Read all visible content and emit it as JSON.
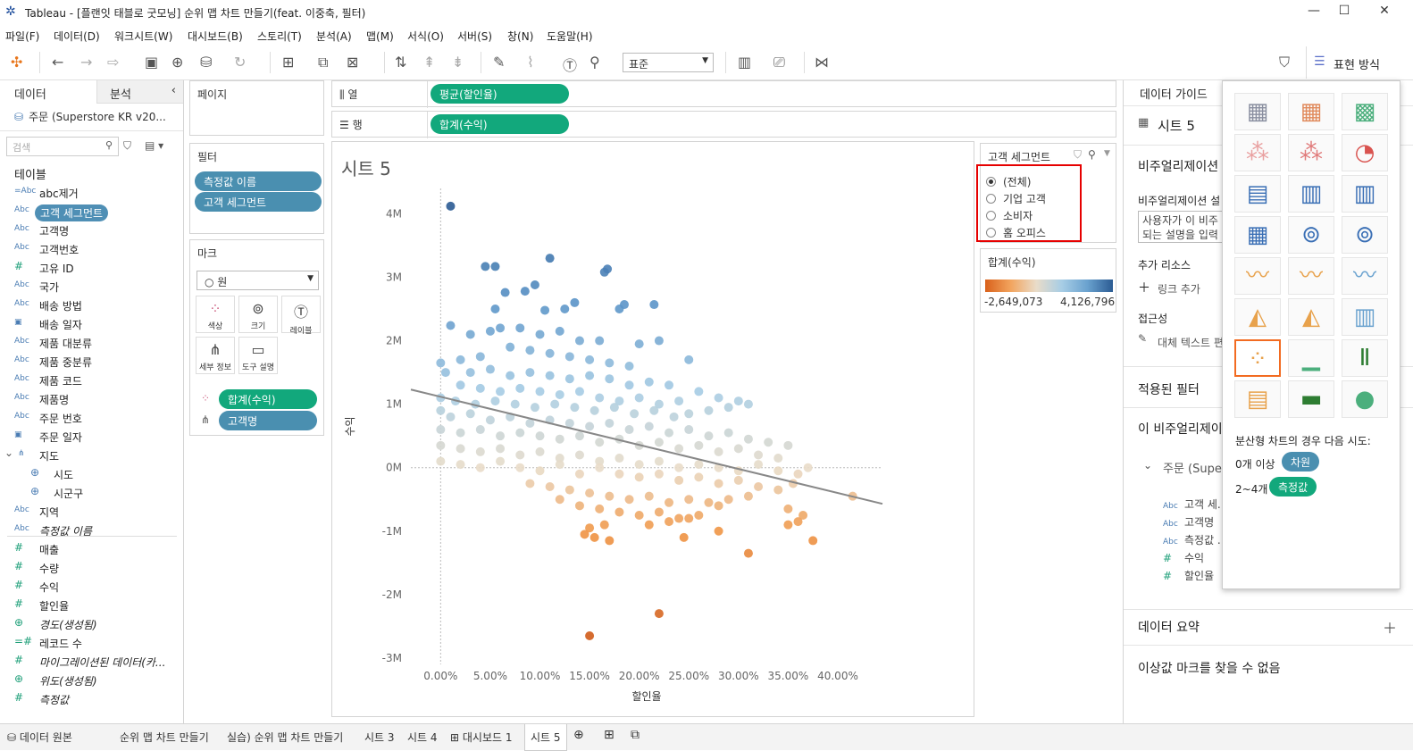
{
  "window": {
    "title": "Tableau - [플랜잇 태블로 굿모닝] 순위 맵 차트 만들기(feat. 이중축, 필터)"
  },
  "menu": [
    "파일(F)",
    "데이터(D)",
    "워크시트(W)",
    "대시보드(B)",
    "스토리(T)",
    "분석(A)",
    "맵(M)",
    "서식(O)",
    "서버(S)",
    "창(N)",
    "도움말(H)"
  ],
  "toolbar": {
    "fit": "표준",
    "showme": "표현 방식"
  },
  "datapane": {
    "tab_data": "데이터",
    "tab_analysis": "분석",
    "source": "주문 (Superstore KR v20...",
    "search_placeholder": "검색",
    "tables_label": "테이블",
    "fields": [
      {
        "icon": "=Abc",
        "name": "abc제거"
      },
      {
        "icon": "Abc",
        "name": "고객 세그먼트",
        "selected": true
      },
      {
        "icon": "Abc",
        "name": "고객명"
      },
      {
        "icon": "Abc",
        "name": "고객번호"
      },
      {
        "icon": "#",
        "name": "고유 ID"
      },
      {
        "icon": "Abc",
        "name": "국가"
      },
      {
        "icon": "Abc",
        "name": "배송 방법"
      },
      {
        "icon": "date",
        "name": "배송 일자"
      },
      {
        "icon": "Abc",
        "name": "제품 대분류"
      },
      {
        "icon": "Abc",
        "name": "제품 중분류"
      },
      {
        "icon": "Abc",
        "name": "제품 코드"
      },
      {
        "icon": "Abc",
        "name": "제품명"
      },
      {
        "icon": "Abc",
        "name": "주문 번호"
      },
      {
        "icon": "date",
        "name": "주문 일자"
      },
      {
        "icon": "geo",
        "name": "지도",
        "folder": true
      },
      {
        "icon": "globe",
        "name": "시도",
        "indent": true
      },
      {
        "icon": "globe",
        "name": "시군구",
        "indent": true
      },
      {
        "icon": "Abc",
        "name": "지역"
      },
      {
        "icon": "Abc",
        "name": "측정값 이름",
        "italic": true
      }
    ],
    "measures": [
      {
        "icon": "#",
        "name": "매출"
      },
      {
        "icon": "#",
        "name": "수량"
      },
      {
        "icon": "#",
        "name": "수익"
      },
      {
        "icon": "#",
        "name": "할인율"
      },
      {
        "icon": "globe",
        "name": "경도(생성됨)",
        "italic": true
      },
      {
        "icon": "=#",
        "name": "레코드 수"
      },
      {
        "icon": "#",
        "name": "마이그레이션된 데이터(카...",
        "italic": true
      },
      {
        "icon": "globe",
        "name": "위도(생성됨)",
        "italic": true
      },
      {
        "icon": "#",
        "name": "측정값",
        "italic": true
      }
    ]
  },
  "shelves": {
    "pages": "페이지",
    "columns_label": "열",
    "columns_pill": "평균(할인율)",
    "rows_label": "행",
    "rows_pill": "합계(수익)",
    "filters": "필터",
    "filter_pills": [
      "측정값 이름",
      "고객 세그먼트"
    ],
    "marks": "마크",
    "mark_type": "원",
    "mark_buttons": [
      "색상",
      "크기",
      "레이블",
      "세부 정보",
      "도구 설명"
    ],
    "mark_pills": [
      "합계(수익)",
      "고객명"
    ]
  },
  "viz": {
    "title": "시트 5"
  },
  "chart_data": {
    "type": "scatter",
    "xlabel": "할인율",
    "ylabel": "수익",
    "xlim": [
      -0.03,
      0.445
    ],
    "ylim": [
      -3.1,
      4.4
    ],
    "x_ticks": [
      "0.00%",
      "5.00%",
      "10.00%",
      "15.00%",
      "20.00%",
      "25.00%",
      "30.00%",
      "35.00%",
      "40.00%"
    ],
    "x_tick_values": [
      0,
      0.05,
      0.1,
      0.15,
      0.2,
      0.25,
      0.3,
      0.35,
      0.4
    ],
    "y_ticks": [
      "4M",
      "3M",
      "2M",
      "1M",
      "0M",
      "-1M",
      "-2M",
      "-3M"
    ],
    "y_tick_values": [
      4,
      3,
      2,
      1,
      0,
      -1,
      -2,
      -3
    ],
    "trend_line": {
      "x": [
        -0.03,
        0.445
      ],
      "y": [
        1.23,
        -0.57
      ]
    },
    "color_range": [
      -2.649073,
      4.126796
    ],
    "points": [
      [
        0.01,
        4.12
      ],
      [
        0.045,
        3.17
      ],
      [
        0.055,
        3.17
      ],
      [
        0.11,
        3.3
      ],
      [
        0.165,
        3.08
      ],
      [
        0.168,
        3.13
      ],
      [
        0.095,
        2.88
      ],
      [
        0.085,
        2.78
      ],
      [
        0.065,
        2.76
      ],
      [
        0.135,
        2.6
      ],
      [
        0.125,
        2.5
      ],
      [
        0.055,
        2.5
      ],
      [
        0.105,
        2.48
      ],
      [
        0.18,
        2.5
      ],
      [
        0.185,
        2.57
      ],
      [
        0.215,
        2.57
      ],
      [
        0.01,
        2.24
      ],
      [
        0.03,
        2.1
      ],
      [
        0.05,
        2.15
      ],
      [
        0.06,
        2.2
      ],
      [
        0.08,
        2.2
      ],
      [
        0.1,
        2.1
      ],
      [
        0.12,
        2.15
      ],
      [
        0.14,
        2.0
      ],
      [
        0.16,
        2.0
      ],
      [
        0.2,
        1.95
      ],
      [
        0.22,
        2.0
      ],
      [
        0.07,
        1.9
      ],
      [
        0.09,
        1.85
      ],
      [
        0.11,
        1.8
      ],
      [
        0.13,
        1.75
      ],
      [
        0.15,
        1.7
      ],
      [
        0.17,
        1.65
      ],
      [
        0.19,
        1.6
      ],
      [
        0.25,
        1.7
      ],
      [
        0.02,
        1.7
      ],
      [
        0.04,
        1.75
      ],
      [
        0.0,
        1.65
      ],
      [
        0.005,
        1.5
      ],
      [
        0.03,
        1.5
      ],
      [
        0.05,
        1.55
      ],
      [
        0.07,
        1.45
      ],
      [
        0.09,
        1.5
      ],
      [
        0.11,
        1.45
      ],
      [
        0.13,
        1.4
      ],
      [
        0.15,
        1.45
      ],
      [
        0.17,
        1.4
      ],
      [
        0.19,
        1.3
      ],
      [
        0.21,
        1.35
      ],
      [
        0.23,
        1.3
      ],
      [
        0.26,
        1.2
      ],
      [
        0.28,
        1.1
      ],
      [
        0.3,
        1.05
      ],
      [
        0.31,
        1.0
      ],
      [
        0.29,
        0.95
      ],
      [
        0.27,
        0.9
      ],
      [
        0.25,
        0.85
      ],
      [
        0.02,
        1.3
      ],
      [
        0.04,
        1.25
      ],
      [
        0.06,
        1.2
      ],
      [
        0.08,
        1.25
      ],
      [
        0.1,
        1.2
      ],
      [
        0.12,
        1.15
      ],
      [
        0.14,
        1.2
      ],
      [
        0.16,
        1.1
      ],
      [
        0.18,
        1.05
      ],
      [
        0.2,
        1.1
      ],
      [
        0.22,
        1.0
      ],
      [
        0.24,
        1.05
      ],
      [
        0.0,
        1.1
      ],
      [
        0.015,
        1.05
      ],
      [
        0.035,
        1.0
      ],
      [
        0.055,
        1.05
      ],
      [
        0.075,
        1.0
      ],
      [
        0.095,
        0.95
      ],
      [
        0.115,
        1.0
      ],
      [
        0.135,
        0.95
      ],
      [
        0.155,
        0.9
      ],
      [
        0.175,
        0.95
      ],
      [
        0.195,
        0.85
      ],
      [
        0.215,
        0.9
      ],
      [
        0.235,
        0.8
      ],
      [
        0.0,
        0.9
      ],
      [
        0.01,
        0.8
      ],
      [
        0.03,
        0.85
      ],
      [
        0.05,
        0.75
      ],
      [
        0.07,
        0.8
      ],
      [
        0.09,
        0.7
      ],
      [
        0.11,
        0.75
      ],
      [
        0.13,
        0.7
      ],
      [
        0.15,
        0.65
      ],
      [
        0.17,
        0.7
      ],
      [
        0.19,
        0.6
      ],
      [
        0.21,
        0.65
      ],
      [
        0.23,
        0.55
      ],
      [
        0.25,
        0.6
      ],
      [
        0.27,
        0.5
      ],
      [
        0.29,
        0.55
      ],
      [
        0.31,
        0.45
      ],
      [
        0.33,
        0.4
      ],
      [
        0.35,
        0.35
      ],
      [
        0.0,
        0.6
      ],
      [
        0.02,
        0.55
      ],
      [
        0.04,
        0.6
      ],
      [
        0.06,
        0.5
      ],
      [
        0.08,
        0.55
      ],
      [
        0.1,
        0.5
      ],
      [
        0.12,
        0.45
      ],
      [
        0.14,
        0.5
      ],
      [
        0.16,
        0.4
      ],
      [
        0.18,
        0.45
      ],
      [
        0.2,
        0.35
      ],
      [
        0.22,
        0.4
      ],
      [
        0.24,
        0.3
      ],
      [
        0.26,
        0.35
      ],
      [
        0.28,
        0.25
      ],
      [
        0.3,
        0.3
      ],
      [
        0.32,
        0.2
      ],
      [
        0.34,
        0.15
      ],
      [
        0.0,
        0.35
      ],
      [
        0.02,
        0.3
      ],
      [
        0.04,
        0.25
      ],
      [
        0.06,
        0.3
      ],
      [
        0.08,
        0.2
      ],
      [
        0.1,
        0.25
      ],
      [
        0.12,
        0.15
      ],
      [
        0.14,
        0.2
      ],
      [
        0.16,
        0.1
      ],
      [
        0.18,
        0.15
      ],
      [
        0.2,
        0.05
      ],
      [
        0.22,
        0.1
      ],
      [
        0.24,
        0.0
      ],
      [
        0.26,
        0.05
      ],
      [
        0.28,
        0.0
      ],
      [
        0.3,
        -0.05
      ],
      [
        0.32,
        0.05
      ],
      [
        0.34,
        -0.05
      ],
      [
        0.36,
        -0.1
      ],
      [
        0.37,
        0.0
      ],
      [
        0.0,
        0.1
      ],
      [
        0.02,
        0.05
      ],
      [
        0.04,
        0.0
      ],
      [
        0.06,
        0.1
      ],
      [
        0.08,
        0.0
      ],
      [
        0.1,
        -0.05
      ],
      [
        0.12,
        0.05
      ],
      [
        0.14,
        -0.1
      ],
      [
        0.16,
        0.0
      ],
      [
        0.18,
        -0.1
      ],
      [
        0.2,
        -0.15
      ],
      [
        0.22,
        -0.1
      ],
      [
        0.24,
        -0.2
      ],
      [
        0.26,
        -0.15
      ],
      [
        0.28,
        -0.25
      ],
      [
        0.3,
        -0.2
      ],
      [
        0.32,
        -0.3
      ],
      [
        0.34,
        -0.35
      ],
      [
        0.355,
        -0.25
      ],
      [
        0.09,
        -0.25
      ],
      [
        0.11,
        -0.3
      ],
      [
        0.13,
        -0.35
      ],
      [
        0.15,
        -0.4
      ],
      [
        0.17,
        -0.45
      ],
      [
        0.19,
        -0.5
      ],
      [
        0.21,
        -0.45
      ],
      [
        0.23,
        -0.55
      ],
      [
        0.25,
        -0.5
      ],
      [
        0.27,
        -0.55
      ],
      [
        0.29,
        -0.5
      ],
      [
        0.31,
        -0.45
      ],
      [
        0.12,
        -0.5
      ],
      [
        0.14,
        -0.6
      ],
      [
        0.16,
        -0.65
      ],
      [
        0.18,
        -0.7
      ],
      [
        0.2,
        -0.75
      ],
      [
        0.22,
        -0.7
      ],
      [
        0.24,
        -0.8
      ],
      [
        0.26,
        -0.75
      ],
      [
        0.28,
        -0.6
      ],
      [
        0.35,
        -0.65
      ],
      [
        0.365,
        -0.75
      ],
      [
        0.415,
        -0.45
      ],
      [
        0.15,
        -0.95
      ],
      [
        0.165,
        -0.9
      ],
      [
        0.145,
        -1.05
      ],
      [
        0.21,
        -0.9
      ],
      [
        0.23,
        -0.85
      ],
      [
        0.25,
        -0.8
      ],
      [
        0.28,
        -1.0
      ],
      [
        0.35,
        -0.9
      ],
      [
        0.36,
        -0.85
      ],
      [
        0.375,
        -1.15
      ],
      [
        0.245,
        -1.1
      ],
      [
        0.17,
        -1.15
      ],
      [
        0.31,
        -1.35
      ],
      [
        0.155,
        -1.1
      ],
      [
        0.22,
        -2.3
      ],
      [
        0.15,
        -2.65
      ]
    ]
  },
  "legends": {
    "segment_title": "고객 세그먼트",
    "segment_options": [
      "(전체)",
      "기업 고객",
      "소비자",
      "홈 오피스"
    ],
    "profit_title": "합계(수익)",
    "profit_min": "-2,649,073",
    "profit_max": "4,126,796"
  },
  "guide": {
    "header": "데이터 가이드",
    "sheet": "시트 5",
    "viz_desc_label": "비주얼리제이션",
    "viz_desc_sub": "비주얼리제이션 설",
    "desc_placeholder_1": "사용자가 이 비주",
    "desc_placeholder_2": "되는 설명을 입력",
    "resources": "추가 리소스",
    "add_link": "링크 추가",
    "access": "접근성",
    "alt_text": "대체 텍스트 편",
    "applied_filters": "적용된 필터",
    "this_viz": "이 비주얼리제이",
    "source": "주문 (Supe",
    "guide_fields": [
      "고객 세...",
      "고객명",
      "측정값 ...",
      "수익",
      "할인율"
    ],
    "summary": "데이터 요약",
    "outliers": "이상값 마크를 찾을 수 없음"
  },
  "showme": {
    "hint": "분산형 차트의 경우 다음 시도:",
    "req1_prefix": "0개 이상",
    "req1_chip": "차원",
    "req2_prefix": "2~4개",
    "req2_chip": "측정값"
  },
  "bottom_tabs": [
    "데이터 원본",
    "순위 맵 차트 만들기",
    "실습) 순위 맵 차트 만들기",
    "시트 3",
    "시트 4",
    "대시보드 1",
    "시트 5"
  ],
  "colors": {
    "pill_blue": "#4a8fb0",
    "pill_green": "#12a87c",
    "highlight": "#e60000",
    "selected_chart": "#f26b21"
  }
}
